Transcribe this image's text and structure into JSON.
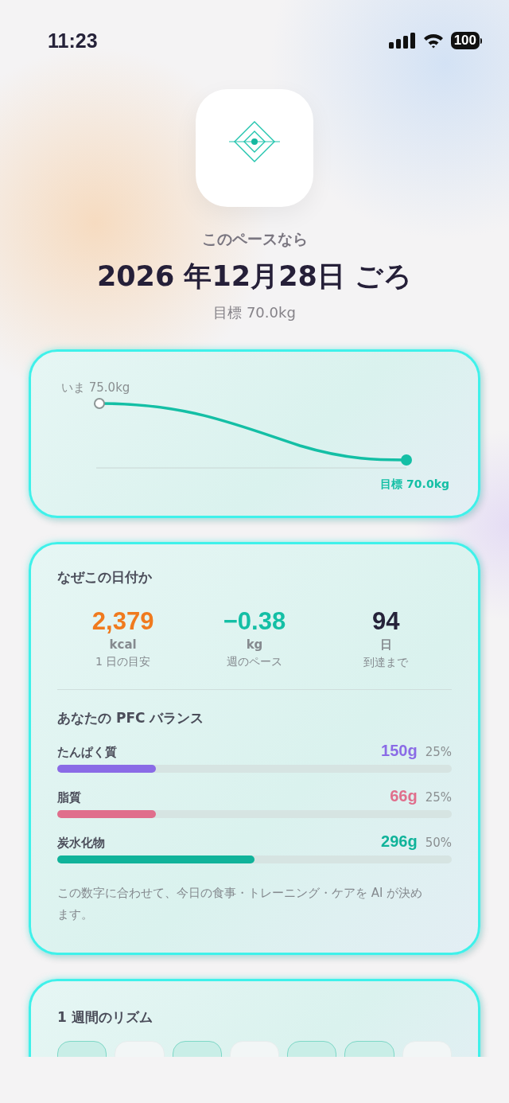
{
  "status_bar": {
    "time": "11:23",
    "battery": "100"
  },
  "header": {
    "lead": "このペースなら",
    "date": "2026 年12月28日 ごろ",
    "goal": "目標 70.0kg"
  },
  "projection": {
    "start_label": "いま 75.0kg",
    "end_label": "目標 70.0kg"
  },
  "why_card": {
    "title": "なぜこの日付か",
    "stats": [
      {
        "value": "2,379",
        "unit": "kcal",
        "caption": "1 日の目安",
        "color": "#f07a1e"
      },
      {
        "value": "−0.38",
        "unit": "kg",
        "caption": "週のペース",
        "color": "#14bfa5"
      },
      {
        "value": "94",
        "unit": "日",
        "caption": "到達まで",
        "color": "#26233a"
      }
    ],
    "pfc_title": "あなたの PFC バランス",
    "macros": [
      {
        "name": "たんぱく質",
        "grams": "150g",
        "percent": "25%",
        "level": 0.25,
        "color": "#8a6be6"
      },
      {
        "name": "脂質",
        "grams": "66g",
        "percent": "25%",
        "level": 0.25,
        "color": "#e06e8c"
      },
      {
        "name": "炭水化物",
        "grams": "296g",
        "percent": "50%",
        "level": 0.5,
        "color": "#10b39a"
      }
    ],
    "note": "この数字に合わせて、今日の食事・トレーニング・ケアを AI が決めます。"
  },
  "rhythm_card": {
    "title": "1 週間のリズム",
    "days": [
      {
        "selected": true
      },
      {
        "selected": false
      },
      {
        "selected": true
      },
      {
        "selected": false
      },
      {
        "selected": true
      },
      {
        "selected": true
      },
      {
        "selected": false
      }
    ]
  }
}
